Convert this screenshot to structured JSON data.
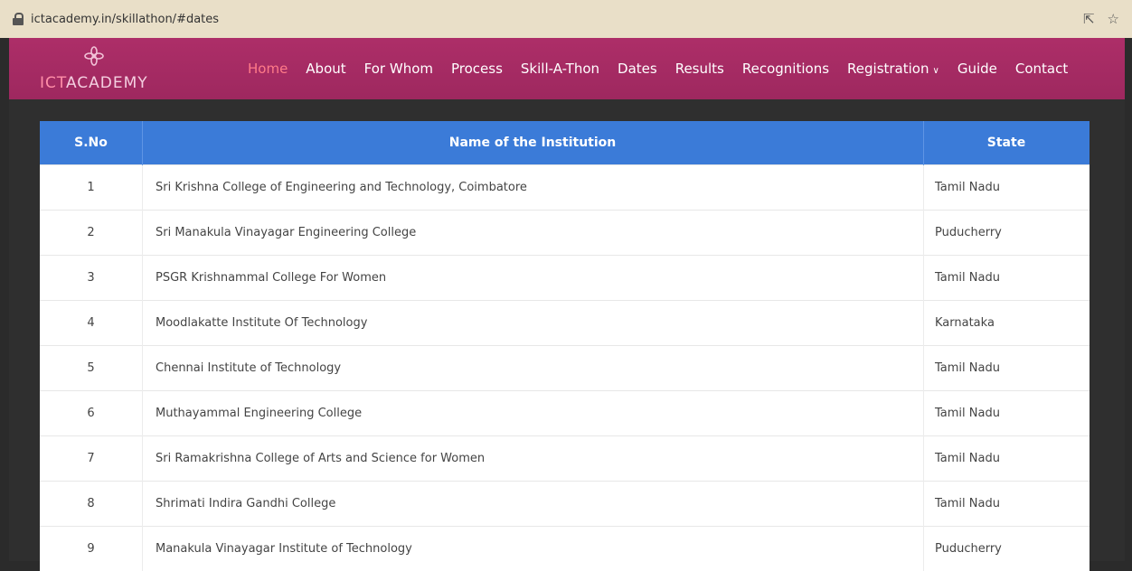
{
  "browser": {
    "url": "ictacademy.in/skillathon/#dates"
  },
  "brand": {
    "prefix": "ICT",
    "suffix": "ACADEMY",
    "accent_color": "#ad2e68"
  },
  "nav": {
    "items": [
      {
        "label": "Home",
        "active": true
      },
      {
        "label": "About"
      },
      {
        "label": "For Whom"
      },
      {
        "label": "Process"
      },
      {
        "label": "Skill-A-Thon"
      },
      {
        "label": "Dates"
      },
      {
        "label": "Results"
      },
      {
        "label": "Recognitions"
      },
      {
        "label": "Registration",
        "dropdown": true
      },
      {
        "label": "Guide"
      },
      {
        "label": "Contact"
      }
    ]
  },
  "table": {
    "header_color": "#3b7bd8",
    "columns": [
      "S.No",
      "Name of the Institution",
      "State"
    ],
    "rows": [
      {
        "sno": "1",
        "name": "Sri Krishna College of Engineering and Technology, Coimbatore",
        "state": "Tamil Nadu"
      },
      {
        "sno": "2",
        "name": "Sri Manakula Vinayagar Engineering College",
        "state": "Puducherry"
      },
      {
        "sno": "3",
        "name": "PSGR Krishnammal College For Women",
        "state": "Tamil Nadu"
      },
      {
        "sno": "4",
        "name": "Moodlakatte Institute Of Technology",
        "state": "Karnataka"
      },
      {
        "sno": "5",
        "name": "Chennai Institute of Technology",
        "state": "Tamil Nadu"
      },
      {
        "sno": "6",
        "name": "Muthayammal Engineering College",
        "state": "Tamil Nadu"
      },
      {
        "sno": "7",
        "name": "Sri Ramakrishna College of Arts and Science for Women",
        "state": "Tamil Nadu"
      },
      {
        "sno": "8",
        "name": "Shrimati Indira Gandhi College",
        "state": "Tamil Nadu"
      },
      {
        "sno": "9",
        "name": "Manakula Vinayagar Institute of Technology",
        "state": "Puducherry"
      }
    ]
  }
}
